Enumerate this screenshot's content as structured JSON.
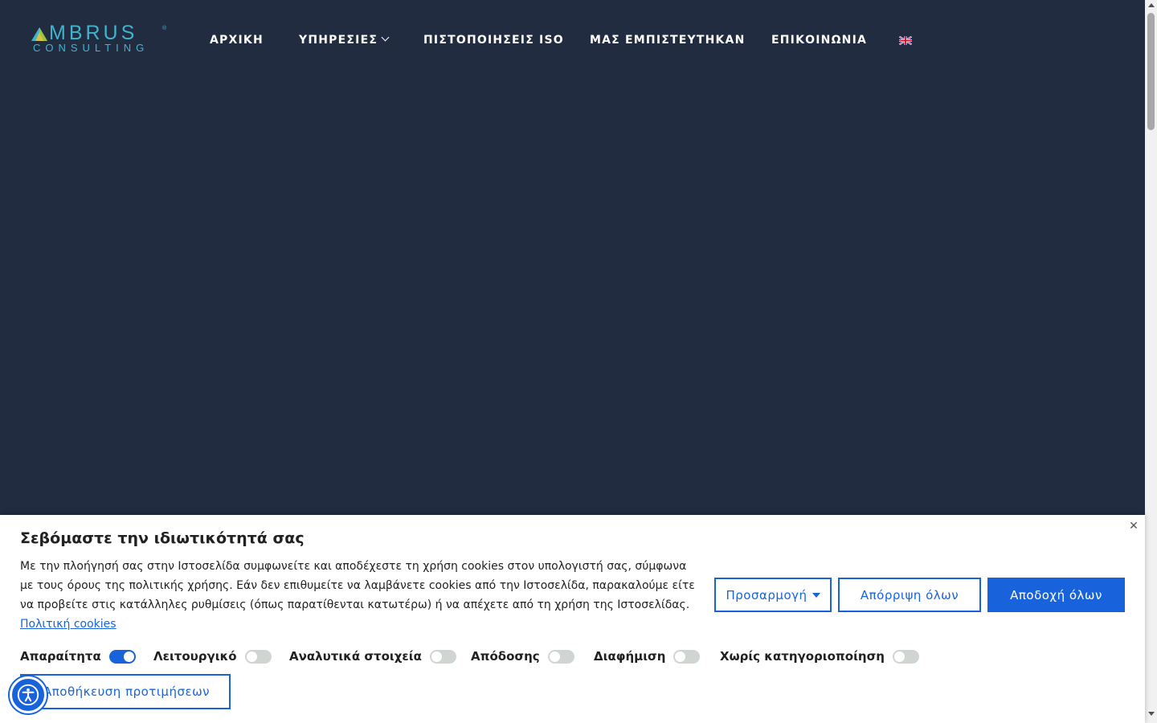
{
  "brand": {
    "name": "MBRUS",
    "registered": "®",
    "subtitle": "CONSULTING",
    "colors": {
      "accent": "#41b3cc",
      "triangle_green": "#9bc53d",
      "background": "#222c40"
    }
  },
  "nav": {
    "items": [
      {
        "label": "ΑΡΧΙΚΗ"
      },
      {
        "label": "ΥΠΗΡΕΣΙΕΣ",
        "has_dropdown": true
      },
      {
        "label": "ΠΙΣΤΟΠΟΙΗΣΕΙΣ ISO"
      },
      {
        "label": "ΜΑΣ ΕΜΠΙΣΤΕΥΤΗΚΑΝ"
      },
      {
        "label": "ΕΠΙΚΟΙΝΩΝΙΑ"
      }
    ],
    "language_icon": "uk-flag-icon"
  },
  "cookie": {
    "title": "Σεβόμαστε την ιδιωτικότητά σας",
    "text": "Με την πλοήγησή σας στην Ιστοσελίδα συμφωνείτε και αποδέχεστε τη χρήση cookies στον υπολογιστή σας, σύμφωνα με τους όρους της πολιτικής χρήσης. Εάν δεν επιθυμείτε να λαμβάνετε cookies από την Ιστοσελίδα, παρακαλούμε είτε να προβείτε στις κατάλληλες ρυθμίσεις (όπως παρατίθενται κατωτέρω) ή να απέχετε από τη χρήση της Ιστοσελίδας.",
    "policy_link": "Πολιτική cookies",
    "buttons": {
      "customize": "Προσαρμογή",
      "reject": "Απόρριψη όλων",
      "accept": "Αποδοχή όλων",
      "save": "Αποθήκευση προτιμήσεων"
    },
    "categories": [
      {
        "label": "Απαραίτητα",
        "enabled": true
      },
      {
        "label": "Λειτουργικό",
        "enabled": false
      },
      {
        "label": "Αναλυτικά στοιχεία",
        "enabled": false
      },
      {
        "label": "Απόδοσης",
        "enabled": false
      },
      {
        "label": "Διαφήμιση",
        "enabled": false
      },
      {
        "label": "Χωρίς κατηγοριοποίηση",
        "enabled": false
      }
    ],
    "accent_color": "#1863dc",
    "close_icon": "close-icon"
  },
  "accessibility_icon": "accessibility-icon"
}
